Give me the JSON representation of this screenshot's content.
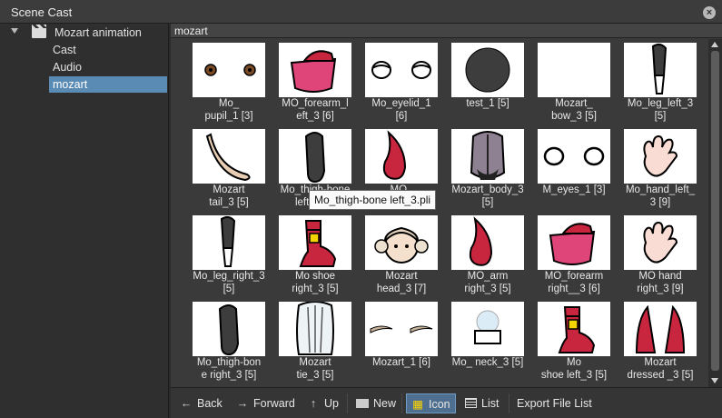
{
  "window": {
    "title": "Scene Cast",
    "close_icon": "close-icon"
  },
  "tree": {
    "root": {
      "label": "Mozart animation",
      "icon": "clapperboard-icon"
    },
    "children": [
      {
        "label": "Cast"
      },
      {
        "label": "Audio"
      },
      {
        "label": "mozart"
      }
    ]
  },
  "breadcrumb": "mozart",
  "items": [
    {
      "label": "Mo_\npupil_1 [3]",
      "art": "pupils"
    },
    {
      "label": "MO_forearm_l\neft_3 [6]",
      "art": "sleeve"
    },
    {
      "label": "Mo_eyelid_1\n[6]",
      "art": "eyelids"
    },
    {
      "label": "test_1 [5]",
      "art": "circle"
    },
    {
      "label": "Mozart_\nbow_3 [5]",
      "art": "blank"
    },
    {
      "label": "Mo_leg_left_3\n[5]",
      "art": "leg"
    },
    {
      "label": "Mozart\ntail_3 [5]",
      "art": "tail"
    },
    {
      "label": "Mo_thigh-bone\nleft_3 [5]",
      "art": "thigh"
    },
    {
      "label": "MO_\nleft_3 [5]",
      "art": "arm"
    },
    {
      "label": "Mozart_body_3\n[5]",
      "art": "body"
    },
    {
      "label": "M_eyes_1 [3]",
      "art": "eyes"
    },
    {
      "label": "Mo_hand_left_\n3 [9]",
      "art": "hand"
    },
    {
      "label": "Mo_leg_right_3\n[5]",
      "art": "leg"
    },
    {
      "label": "Mo shoe\nright_3 [5]",
      "art": "shoe"
    },
    {
      "label": "Mozart\nhead_3 [7]",
      "art": "head"
    },
    {
      "label": "MO_arm\nright_3 [5]",
      "art": "arm"
    },
    {
      "label": "MO_forearm\nright__3 [6]",
      "art": "sleeve"
    },
    {
      "label": "MO hand\nright_3 [9]",
      "art": "hand"
    },
    {
      "label": "Mo_thigh-bon\ne right_3 [5]",
      "art": "thigh"
    },
    {
      "label": "Mozart\ntie_3 [5]",
      "art": "tie"
    },
    {
      "label": "Mozart_1 [6]",
      "art": "brows"
    },
    {
      "label": "Mo_ neck_3 [5]",
      "art": "neck"
    },
    {
      "label": "Mo\nshoe left_3 [5]",
      "art": "shoe"
    },
    {
      "label": "Mozart\ndressed _3 [5]",
      "art": "coat"
    }
  ],
  "tooltip": "Mo_thigh-bone left_3.pli",
  "toolbar": {
    "back": "Back",
    "forward": "Forward",
    "up": "Up",
    "new": "New",
    "icon": "Icon",
    "list": "List",
    "export": "Export File List"
  },
  "colors": {
    "selection": "#5a8bb5",
    "accent_yellow": "#ffd400",
    "crimson": "#c8263f"
  }
}
